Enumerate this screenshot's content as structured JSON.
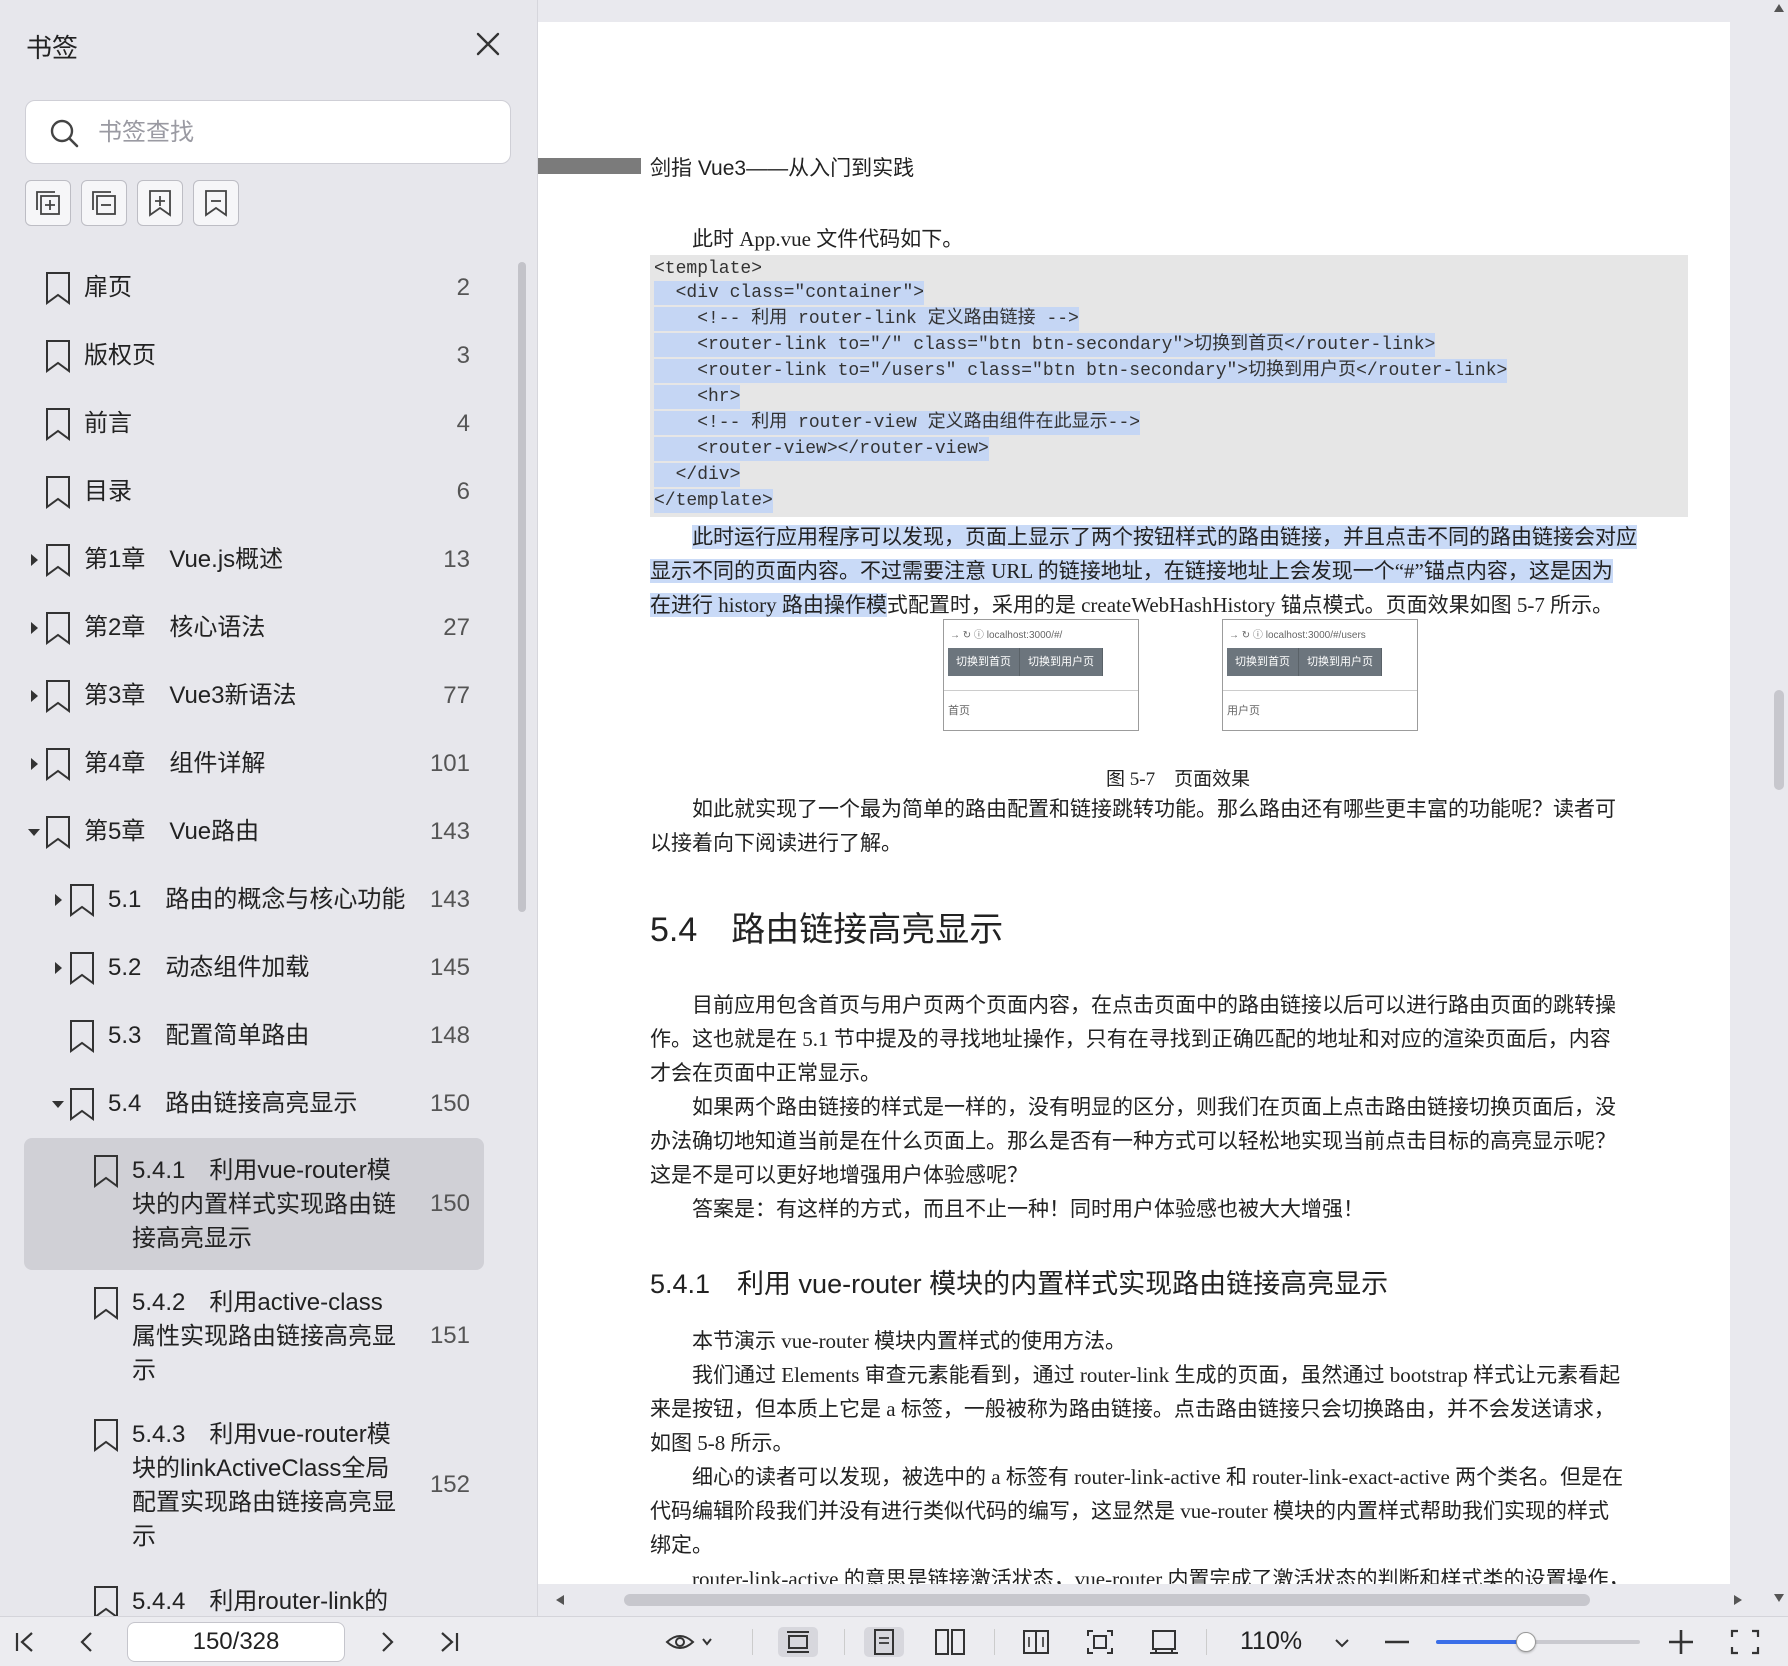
{
  "sidebar": {
    "title": "书签",
    "search_placeholder": "书签查找",
    "items": [
      {
        "label": "扉页",
        "page": "2",
        "level": 0,
        "arrow": "none"
      },
      {
        "label": "版权页",
        "page": "3",
        "level": 0,
        "arrow": "none"
      },
      {
        "label": "前言",
        "page": "4",
        "level": 0,
        "arrow": "none"
      },
      {
        "label": "目录",
        "page": "6",
        "level": 0,
        "arrow": "none"
      },
      {
        "label": "第1章　Vue.js概述",
        "page": "13",
        "level": 0,
        "arrow": "collapsed"
      },
      {
        "label": "第2章　核心语法",
        "page": "27",
        "level": 0,
        "arrow": "collapsed"
      },
      {
        "label": "第3章　Vue3新语法",
        "page": "77",
        "level": 0,
        "arrow": "collapsed"
      },
      {
        "label": "第4章　组件详解",
        "page": "101",
        "level": 0,
        "arrow": "collapsed"
      },
      {
        "label": "第5章　Vue路由",
        "page": "143",
        "level": 0,
        "arrow": "expanded"
      },
      {
        "label": "5.1　路由的概念与核心功能",
        "page": "143",
        "level": 1,
        "arrow": "collapsed"
      },
      {
        "label": "5.2　动态组件加载",
        "page": "145",
        "level": 1,
        "arrow": "collapsed"
      },
      {
        "label": "5.3　配置简单路由",
        "page": "148",
        "level": 1,
        "arrow": "none"
      },
      {
        "label": "5.4　路由链接高亮显示",
        "page": "150",
        "level": 1,
        "arrow": "expanded"
      },
      {
        "label": "5.4.1　利用vue-router模块的内置样式实现路由链接高亮显示",
        "lines": [
          "5.4.1　利用vue-router模",
          "块的内置样式实现路由链",
          "接高亮显示"
        ],
        "page": "150",
        "level": 2,
        "arrow": "none",
        "selected": true
      },
      {
        "label": "5.4.2　利用active-class属性实现路由链接高亮显示",
        "lines": [
          "5.4.2　利用active-class",
          "属性实现路由链接高亮显",
          "示"
        ],
        "page": "151",
        "level": 2,
        "arrow": "none"
      },
      {
        "label": "5.4.3　利用vue-router模块的linkActiveClass全局配置实现路由链接高亮显示",
        "lines": [
          "5.4.3　利用vue-router模",
          "块的linkActiveClass全局",
          "配置实现路由链接高亮显",
          "示"
        ],
        "page": "152",
        "level": 2,
        "arrow": "none"
      },
      {
        "label": "5.4.4　利用router-link的",
        "page": "",
        "level": 2,
        "arrow": "none"
      }
    ]
  },
  "document": {
    "running_header": "剑指 Vue3——从入门到实践",
    "intro": "此时 App.vue 文件代码如下。",
    "code_lines": [
      "<template>",
      "  <div class=\"container\">",
      "    <!-- 利用 router-link 定义路由链接 -->",
      "    <router-link to=\"/\" class=\"btn btn-secondary\">切换到首页</router-link>",
      "    <router-link to=\"/users\" class=\"btn btn-secondary\">切换到用户页</router-link>",
      "    <hr>",
      "    <!-- 利用 router-view 定义路由组件在此显示-->",
      "    <router-view></router-view>",
      "  </div>",
      "</template>"
    ],
    "para1_line1": "此时运行应用程序可以发现，页面上显示了两个按钮样式的路由链接，并且点击不同的路由链接会对应",
    "para1_line2": "显示不同的页面内容。不过需要注意 URL 的链接地址，在链接地址上会发现一个“#”锚点内容，这是因为",
    "para1_line3_hl": "在进行 history 路由操作模",
    "para1_line3_rest": "式配置时，采用的是 createWebHashHistory 锚点模式。页面效果如图 5-7 所示。",
    "figures": [
      {
        "url": "localhost:3000/#/",
        "btn1": "切换到首页",
        "btn2": "切换到用户页",
        "label": "首页"
      },
      {
        "url": "localhost:3000/#/users",
        "btn1": "切换到首页",
        "btn2": "切换到用户页",
        "label": "用户页"
      }
    ],
    "figure_caption": "图 5-7　页面效果",
    "para2_lines": [
      "如此就实现了一个最为简单的路由配置和链接跳转功能。那么路由还有哪些更丰富的功能呢？读者可",
      "以接着向下阅读进行了解。"
    ],
    "section_heading": "5.4　路由链接高亮显示",
    "para3_lines": [
      "目前应用包含首页与用户页两个页面内容，在点击页面中的路由链接以后可以进行路由页面的跳转操",
      "作。这也就是在 5.1 节中提及的寻找地址操作，只有在寻找到正确匹配的地址和对应的渲染页面后，内容",
      "才会在页面中正常显示。"
    ],
    "para4_lines": [
      "如果两个路由链接的样式是一样的，没有明显的区分，则我们在页面上点击路由链接切换页面后，没",
      "办法确切地知道当前是在什么页面上。那么是否有一种方式可以轻松地实现当前点击目标的高亮显示呢？",
      "这是不是可以更好地增强用户体验感呢？"
    ],
    "para5": "答案是：有这样的方式，而且不止一种！同时用户体验感也被大大增强！",
    "subsection_heading": "5.4.1　利用 vue-router 模块的内置样式实现路由链接高亮显示",
    "para6": "本节演示 vue-router 模块内置样式的使用方法。",
    "para7_lines": [
      "我们通过 Elements 审查元素能看到，通过 router-link 生成的页面，虽然通过 bootstrap 样式让元素看起",
      "来是按钮，但本质上它是 a 标签，一般被称为路由链接。点击路由链接只会切换路由，并不会发送请求，",
      "如图 5-8 所示。"
    ],
    "para8_lines": [
      "细心的读者可以发现，被选中的 a 标签有 router-link-active 和 router-link-exact-active 两个类名。但是在",
      "代码编辑阶段我们并没有进行类似代码的编写，这显然是 vue-router 模块的内置样式帮助我们实现的样式",
      "绑定。"
    ],
    "para9_partial": "router-link-active 的意思是链接激活状态，vue-router 内置完成了激活状态的判断和样式类的设置操作，"
  },
  "toolbar": {
    "page_indicator": "150/328",
    "zoom_label": "110%",
    "zoom_slider_fraction": 0.44
  },
  "colors": {
    "selection_highlight": "#c9daf7",
    "slider_accent": "#3a6ee8"
  }
}
